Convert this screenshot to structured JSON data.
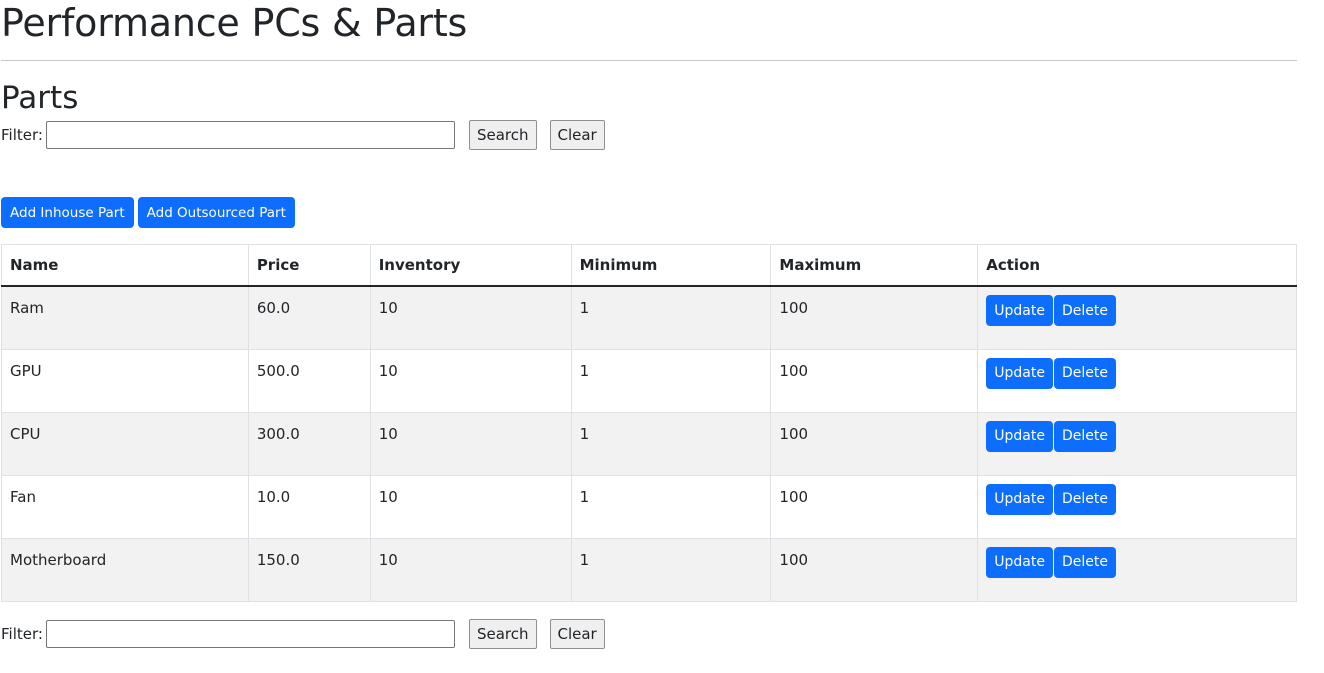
{
  "header": {
    "title": "Performance PCs & Parts"
  },
  "section": {
    "title": "Parts"
  },
  "filter": {
    "label": "Filter:",
    "value": "",
    "search_label": "Search",
    "clear_label": "Clear"
  },
  "actions": {
    "add_inhouse_label": "Add Inhouse Part",
    "add_outsourced_label": "Add Outsourced Part"
  },
  "table": {
    "columns": [
      "Name",
      "Price",
      "Inventory",
      "Minimum",
      "Maximum",
      "Action"
    ],
    "rows": [
      {
        "name": "Ram",
        "price": "60.0",
        "inventory": "10",
        "minimum": "1",
        "maximum": "100"
      },
      {
        "name": "GPU",
        "price": "500.0",
        "inventory": "10",
        "minimum": "1",
        "maximum": "100"
      },
      {
        "name": "CPU",
        "price": "300.0",
        "inventory": "10",
        "minimum": "1",
        "maximum": "100"
      },
      {
        "name": "Fan",
        "price": "10.0",
        "inventory": "10",
        "minimum": "1",
        "maximum": "100"
      },
      {
        "name": "Motherboard",
        "price": "150.0",
        "inventory": "10",
        "minimum": "1",
        "maximum": "100"
      }
    ],
    "update_label": "Update",
    "delete_label": "Delete"
  },
  "colors": {
    "primary": "#0d6efd",
    "stripe": "#f2f2f2",
    "text": "#212529"
  }
}
